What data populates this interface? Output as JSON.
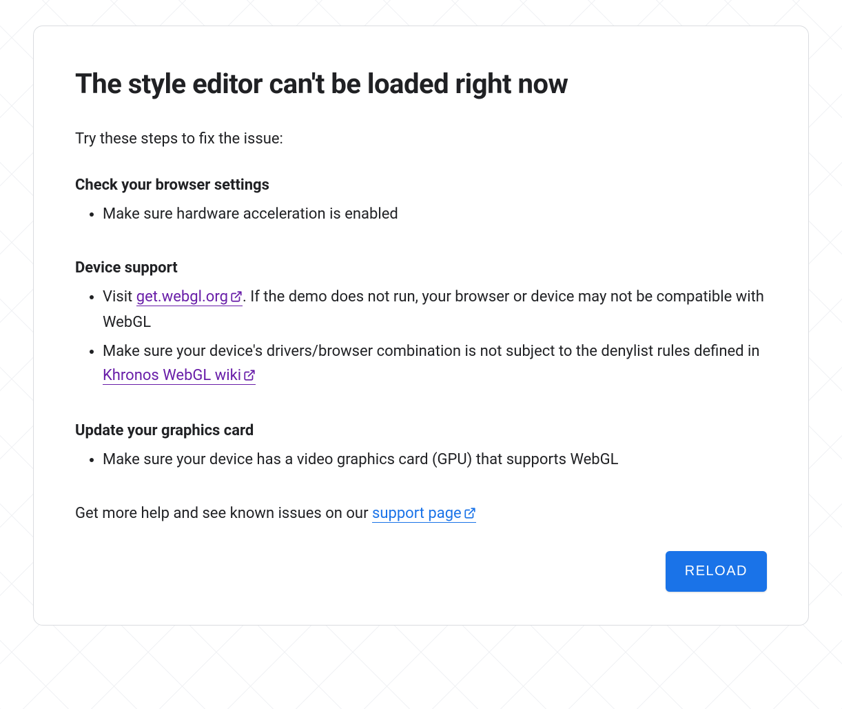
{
  "title": "The style editor can't be loaded right now",
  "intro": "Try these steps to fix the issue:",
  "sections": [
    {
      "heading": "Check your browser settings",
      "items": [
        "Make sure hardware acceleration is enabled"
      ]
    },
    {
      "heading": "Device support",
      "items": [
        {
          "prefix": "Visit ",
          "link": "get.webgl.org",
          "suffix": ". If the demo does not run, your browser or device may not be compatible with WebGL"
        },
        {
          "prefix": "Make sure your device's drivers/browser combination is not subject to the denylist rules defined in ",
          "link": "Khronos WebGL wiki",
          "suffix": ""
        }
      ]
    },
    {
      "heading": "Update your graphics card",
      "items": [
        "Make sure your device has a video graphics card (GPU) that supports WebGL"
      ]
    }
  ],
  "footer": {
    "prefix": "Get more help and see known issues on our ",
    "link": "support page"
  },
  "reload_button": "RELOAD",
  "colors": {
    "link_visited": "#681da8",
    "link_blue": "#1a73e8",
    "button_bg": "#1a73e8"
  }
}
